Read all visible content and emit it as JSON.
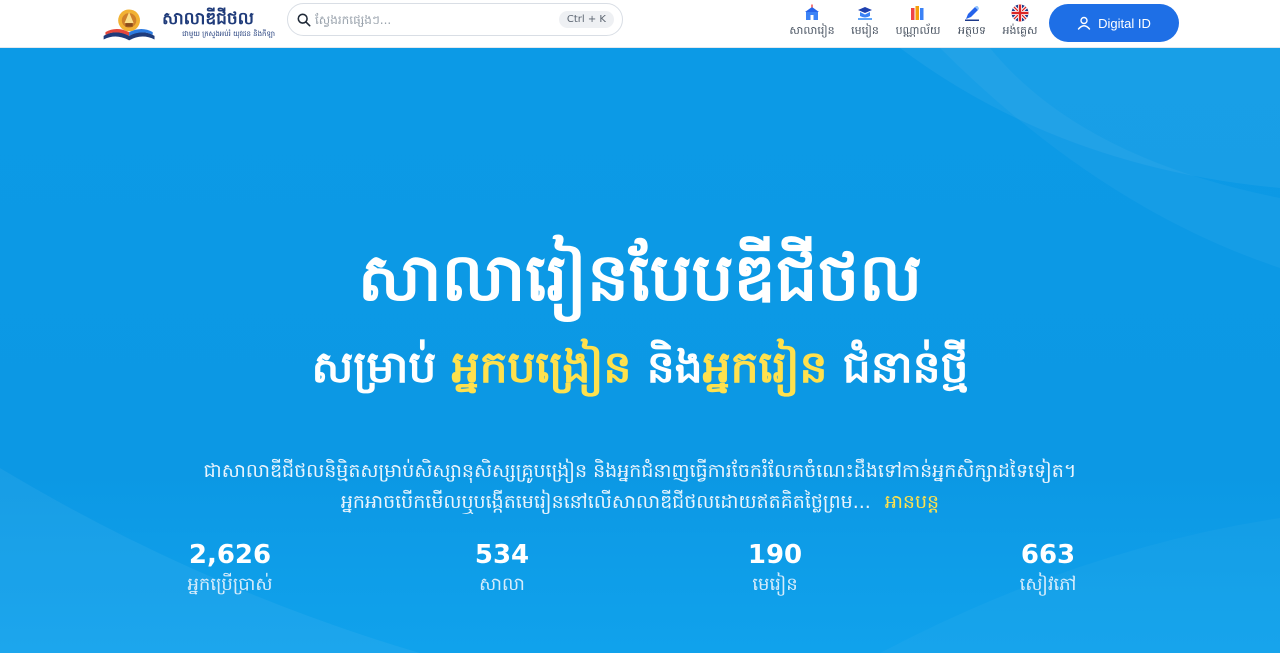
{
  "header": {
    "logo": {
      "title": "សាលាឌីជីថល",
      "subtitle": "ជាមួយ ក្រសួងអប់រំ យុវជន និងកីឡា"
    },
    "search": {
      "placeholder": "ស្វែងរកផ្សេងៗ...",
      "shortcut": "Ctrl + K"
    },
    "nav": [
      {
        "label": "សាលារៀន",
        "icon": "school-icon"
      },
      {
        "label": "មេរៀន",
        "icon": "lesson-icon"
      },
      {
        "label": "បណ្ណាល័យ",
        "icon": "library-icon"
      },
      {
        "label": "អត្ថបទ",
        "icon": "article-icon"
      },
      {
        "label": "អង់គ្លេស",
        "icon": "uk-flag-icon"
      }
    ],
    "digital_id_label": "Digital ID"
  },
  "hero": {
    "title": "សាលារៀនបែបឌីជីថល",
    "subtitle": {
      "part1": "សម្រាប់ ",
      "part2": "អ្នកបង្រៀន",
      "part3": " និង",
      "part4": "អ្នករៀន",
      "part5": " ជំនាន់ថ្មី"
    },
    "description": "ជាសាលាឌីជីថលនិម្មិតសម្រាប់សិស្សានុសិស្សគ្រូបង្រៀន និងអ្នកជំនាញធ្វើការចែករំលែកចំណេះដឹងទៅកាន់អ្នកសិក្សាដទៃទៀត។ អ្នកអាចបើកមើលឬបង្កើតមេរៀននៅលើសាលាឌីជីថលដោយឥតគិតថ្លៃព្រម...",
    "read_more": "អានបន្ត",
    "stats": [
      {
        "value": "2,626",
        "label": "អ្នកប្រើប្រាស់"
      },
      {
        "value": "534",
        "label": "សាលា"
      },
      {
        "value": "190",
        "label": "មេរៀន"
      },
      {
        "value": "663",
        "label": "សៀវភៅ"
      }
    ]
  },
  "colors": {
    "hero_bg": "#0d9de8",
    "accent_yellow": "#ffe14d",
    "button_blue": "#1e6fe6",
    "brand_navy": "#1f3b7a"
  }
}
